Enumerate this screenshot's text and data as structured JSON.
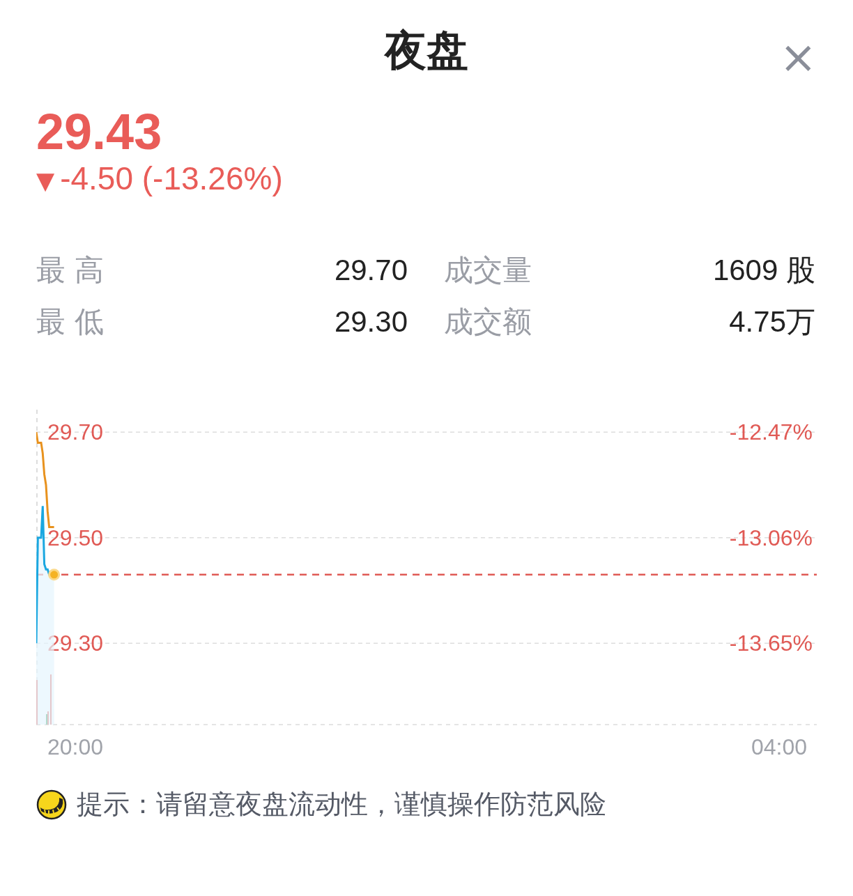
{
  "header": {
    "title": "夜盘",
    "close": "×"
  },
  "quote": {
    "price": "29.43",
    "arrow": "▼",
    "change": "-4.50 (-13.26%)"
  },
  "stats": [
    {
      "label": "最 高",
      "value": "29.70",
      "label2": "成交量",
      "value2": "1609 股"
    },
    {
      "label": "最 低",
      "value": "29.30",
      "label2": "成交额",
      "value2": "4.75万"
    }
  ],
  "chart": {
    "price_labels": [
      "29.70",
      "29.50",
      "29.30"
    ],
    "right_labels": [
      "-12.47%",
      "-13.06%",
      "-13.65%"
    ],
    "time_labels": [
      "20:00",
      "04:00"
    ]
  },
  "notice": "提示：请留意夜盘流动性，谨慎操作防范风险"
}
